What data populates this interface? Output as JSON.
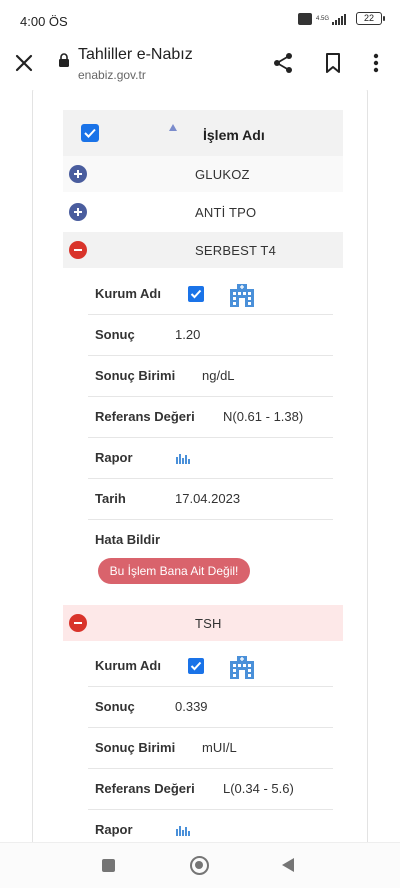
{
  "status_bar": {
    "time": "4:00 ÖS",
    "network": "4.5G",
    "battery": "22"
  },
  "browser": {
    "title": "Tahliller e-Nabız",
    "url": "enabiz.gov.tr"
  },
  "table": {
    "header_label": "İşlem Adı",
    "rows": [
      {
        "name": "GLUKOZ",
        "expanded": false
      },
      {
        "name": "ANTİ TPO",
        "expanded": false
      },
      {
        "name": "SERBEST T4",
        "expanded": true
      },
      {
        "name": "TSH",
        "expanded": true
      }
    ]
  },
  "labels": {
    "institution": "Kurum Adı",
    "result": "Sonuç",
    "unit": "Sonuç Birimi",
    "reference": "Referans Değeri",
    "report": "Rapor",
    "date": "Tarih",
    "report_error": "Hata Bildir"
  },
  "serbest_t4": {
    "result": "1.20",
    "unit": "ng/dL",
    "reference": "N(0.61 - 1.38)",
    "date": "17.04.2023",
    "error_button": "Bu İşlem Bana Ait Değil!"
  },
  "tsh": {
    "result": "0.339",
    "unit": "mUI/L",
    "reference": "L(0.34 - 5.6)"
  },
  "colors": {
    "checkbox": "#1a73e8",
    "plus_toggle": "#4a5d9e",
    "minus_toggle": "#d9342b",
    "error_button": "#d9636c",
    "hospital_icon": "#4a90d9"
  }
}
